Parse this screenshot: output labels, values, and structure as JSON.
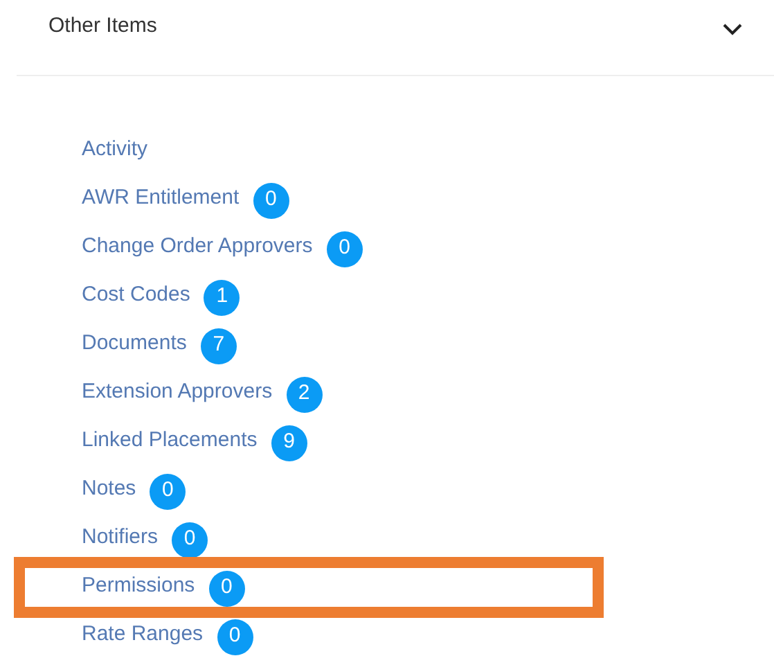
{
  "section": {
    "title": "Other Items",
    "expanded": true
  },
  "items": [
    {
      "label": "Activity",
      "highlighted": false
    },
    {
      "label": "AWR Entitlement",
      "count": "0",
      "highlighted": false
    },
    {
      "label": "Change Order Approvers",
      "count": "0",
      "highlighted": false
    },
    {
      "label": "Cost Codes",
      "count": "1",
      "highlighted": false
    },
    {
      "label": "Documents",
      "count": "7",
      "highlighted": false
    },
    {
      "label": "Extension Approvers",
      "count": "2",
      "highlighted": false
    },
    {
      "label": "Linked Placements",
      "count": "9",
      "highlighted": false
    },
    {
      "label": "Notes",
      "count": "0",
      "highlighted": false
    },
    {
      "label": "Notifiers",
      "count": "0",
      "highlighted": false
    },
    {
      "label": "Permissions",
      "count": "0",
      "highlighted": true
    },
    {
      "label": "Rate Ranges",
      "count": "0",
      "highlighted": false
    }
  ]
}
